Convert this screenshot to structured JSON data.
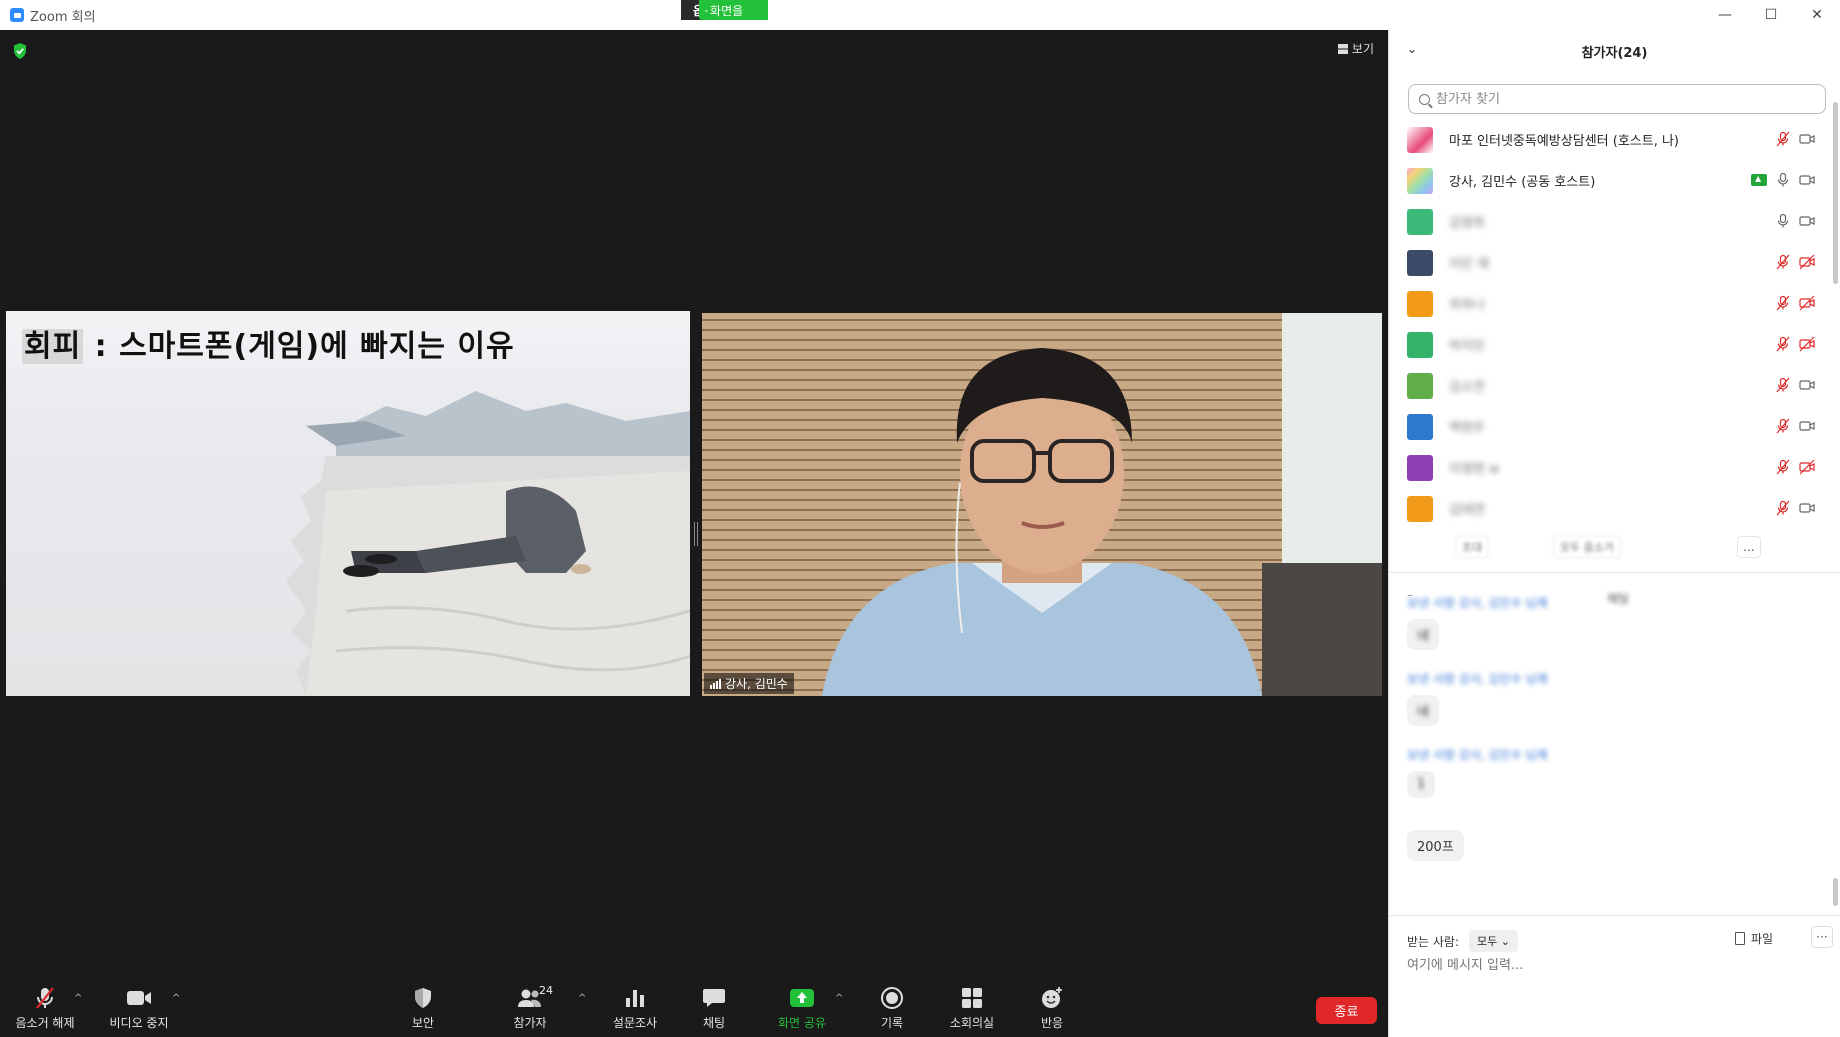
{
  "window": {
    "title": "Zoom 회의",
    "minimize": "—",
    "maximize": "☐",
    "close": "✕"
  },
  "share_banner": {
    "message": "강사, 김민수의 화면을 보고 있습니다.",
    "options": "옵션 보기 ⌄"
  },
  "meeting": {
    "view_label": "보기",
    "slide_title_highlight": "회피",
    "slide_title_rest": " : 스마트폰(게임)에 빠지는 이유",
    "speaker_name": "강사, 김민수"
  },
  "toolbar": {
    "unmute": "음소거 해제",
    "stop_video": "비디오 중지",
    "security": "보안",
    "participants": "참가자",
    "participants_count": "24",
    "polls": "설문조사",
    "chat": "채팅",
    "share_screen": "화면 공유",
    "record": "기록",
    "breakout": "소회의실",
    "reactions": "반응",
    "end": "종료",
    "share_color": "#23c13a",
    "end_color": "#e02828"
  },
  "panel": {
    "title": "참가자(24)",
    "search_placeholder": "참가자 찾기",
    "participants": [
      {
        "name": "마포 인터넷중독예방상담센터 (호스트, 나)",
        "color": "#e84a7a",
        "mic": "muted",
        "cam": "on"
      },
      {
        "name": "강사, 김민수 (공동 호스트)",
        "color": "#9fc4f0",
        "mic": "on",
        "cam": "on",
        "sharing": true
      },
      {
        "name": "김영희",
        "color": "#3cb878",
        "mic": "on",
        "cam": "on"
      },
      {
        "name": "이민 재",
        "color": "#3b4a66",
        "mic": "muted",
        "cam": "off"
      },
      {
        "name": "최하나",
        "color": "#f29b1b",
        "mic": "muted",
        "cam": "off"
      },
      {
        "name": "박지민",
        "color": "#34b36b",
        "mic": "muted",
        "cam": "off"
      },
      {
        "name": "김소연",
        "color": "#5fae4a",
        "mic": "muted",
        "cam": "on"
      },
      {
        "name": "백현우",
        "color": "#2f7ad1",
        "mic": "muted",
        "cam": "on"
      },
      {
        "name": "이영현 w",
        "color": "#8d3fb5",
        "mic": "muted",
        "cam": "off"
      },
      {
        "name": "김태연",
        "color": "#f29b1b",
        "mic": "muted",
        "cam": "on"
      }
    ],
    "action_invite": "초대",
    "action_mute_all": "모두 음소거",
    "action_more": "...",
    "chat_dash": "–",
    "chat_title": "채팅",
    "messages": [
      {
        "from": "보낸 사람 강사, 김민수 님께",
        "text": "네"
      },
      {
        "from": "보낸 사람 강사, 김민수 님께",
        "text": "네"
      },
      {
        "from": "보낸 사람 강사, 김민수 님께",
        "text": "1"
      },
      {
        "from": "",
        "text": "200프"
      }
    ],
    "to_label": "받는 사람:",
    "to_value": "모두 ⌄",
    "file_label": "파일",
    "more_label": "···",
    "input_placeholder": "여기에 메시지 입력..."
  }
}
